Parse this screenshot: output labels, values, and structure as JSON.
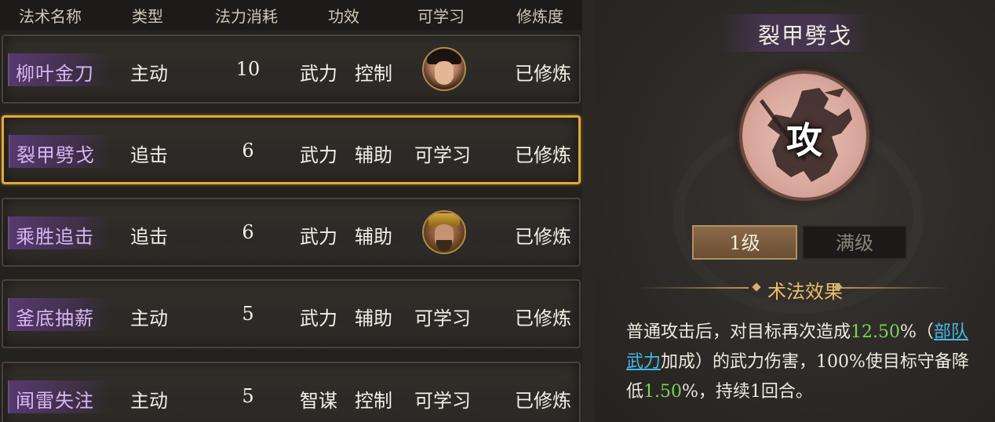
{
  "header": {
    "columns": [
      "法术名称",
      "类型",
      "法力消耗",
      "功效",
      "可学习",
      "修炼度"
    ]
  },
  "rows": [
    {
      "name": "柳叶金刀",
      "type": "主动",
      "cost": "10",
      "effect1": "武力",
      "effect2": "控制",
      "learn": "",
      "learn_icon": "female-general-portrait-icon",
      "progress": "已修炼"
    },
    {
      "name": "裂甲劈戈",
      "type": "追击",
      "cost": "6",
      "effect1": "武力",
      "effect2": "辅助",
      "learn": "可学习",
      "learn_icon": "",
      "progress": "已修炼",
      "selected": true
    },
    {
      "name": "乘胜追击",
      "type": "追击",
      "cost": "6",
      "effect1": "武力",
      "effect2": "辅助",
      "learn": "",
      "learn_icon": "male-general-portrait-icon",
      "progress": "已修炼"
    },
    {
      "name": "釜底抽薪",
      "type": "主动",
      "cost": "5",
      "effect1": "武力",
      "effect2": "辅助",
      "learn": "可学习",
      "learn_icon": "",
      "progress": "已修炼"
    },
    {
      "name": "闻雷失注",
      "type": "主动",
      "cost": "5",
      "effect1": "智谋",
      "effect2": "控制",
      "learn": "可学习",
      "learn_icon": "",
      "progress": "已修炼"
    }
  ],
  "detail": {
    "title": "裂甲劈戈",
    "emblem_glyph": "攻",
    "emblem_icon": "attack-warrior-emblem-icon",
    "levels": [
      "1级",
      "满级"
    ],
    "active_level": "1级",
    "effect_title": "术法效果",
    "effect": {
      "part1": "普通攻击后，对目标再次造成",
      "value1": "12.50",
      "part2": "%（",
      "link": "部队武力",
      "part3": "加成）的武力伤害，100%使目标守备降低",
      "value2": "1.50",
      "part4": "%，持续1回合。"
    }
  },
  "colors": {
    "selected_border": "#e2a93a",
    "skill_name": "#d8b6f2",
    "value_green": "#7ad35a",
    "link_blue": "#45b8e8",
    "effect_title": "#e7bf6c"
  }
}
